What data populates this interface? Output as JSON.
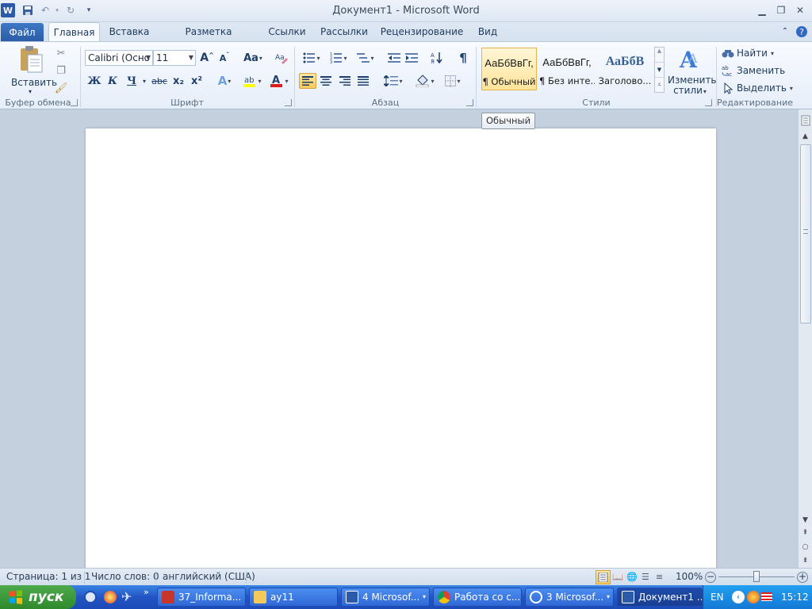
{
  "window": {
    "title": "Документ1  -  Microsoft Word"
  },
  "tabs": [
    {
      "label": "Файл"
    },
    {
      "label": "Главная"
    },
    {
      "label": "Вставка"
    },
    {
      "label": "Разметка страницы"
    },
    {
      "label": "Ссылки"
    },
    {
      "label": "Рассылки"
    },
    {
      "label": "Рецензирование"
    },
    {
      "label": "Вид"
    }
  ],
  "groups": {
    "clipboard": {
      "label": "Буфер обмена",
      "paste_label": "Вставить"
    },
    "font": {
      "label": "Шрифт",
      "font_name": "Calibri (Осно",
      "font_size": "11",
      "bold": "Ж",
      "italic": "К",
      "underline": "Ч",
      "strike": "abc",
      "sub": "x₂",
      "sup": "x²",
      "grow": "A",
      "shrink": "A",
      "case": "Aa",
      "effects": "A",
      "color": "A"
    },
    "paragraph": {
      "label": "Абзац",
      "pilcrow": "¶"
    },
    "styles": {
      "label": "Стили",
      "items": [
        {
          "sample": "АаБбВвГг,",
          "name": "¶ Обычный"
        },
        {
          "sample": "АаБбВвГг,",
          "name": "¶ Без инте..."
        },
        {
          "sample": "АаБбВ",
          "name": "Заголово..."
        }
      ],
      "change_label_1": "Изменить",
      "change_label_2": "стили"
    },
    "editing": {
      "label": "Редактирование",
      "find": "Найти",
      "replace": "Заменить",
      "select": "Выделить"
    }
  },
  "tooltip": "Обычный",
  "status": {
    "page": "Страница: 1 из 1",
    "words": "Число слов: 0",
    "language": "английский (США)",
    "zoom": "100%"
  },
  "taskbar": {
    "start": "пуск",
    "tasks": [
      {
        "label": "37_Informa..."
      },
      {
        "label": "ay11"
      },
      {
        "label": "4 Microsof..."
      },
      {
        "label": "Работа со с..."
      },
      {
        "label": "3 Microsof..."
      },
      {
        "label": "Документ1 ..."
      }
    ],
    "lang": "EN",
    "clock": "15:12"
  },
  "colors": {
    "accent": "#2a5ba6",
    "taskbar": "#2354c4",
    "highlight": "#f9c95a"
  }
}
